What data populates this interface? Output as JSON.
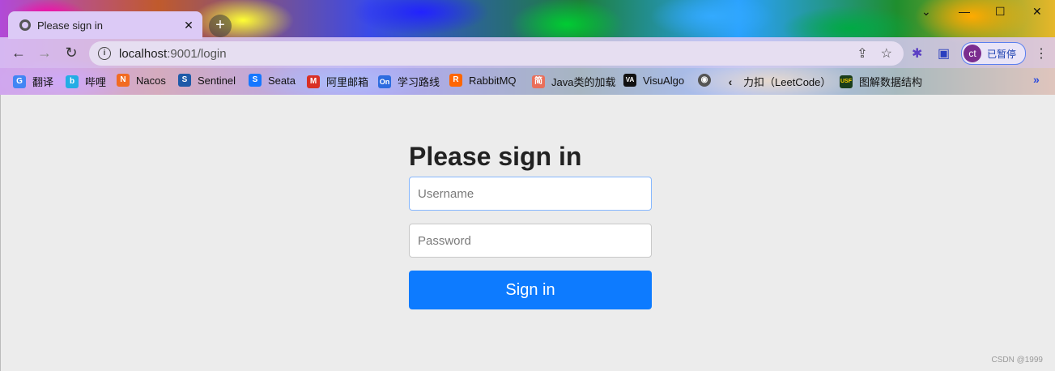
{
  "browser": {
    "tab_title": "Please sign in",
    "tab_close": "✕",
    "new_tab": "+",
    "url_host": "localhost",
    "url_rest": ":9001/login",
    "profile_initials": "ct",
    "profile_label": "已暂停",
    "bookmarks": [
      {
        "label": "翻译",
        "icon": "google-translate-icon",
        "color": "#4285f4",
        "glyph": "G"
      },
      {
        "label": "哔哩",
        "icon": "bilibili-icon",
        "color": "#23ade5",
        "glyph": "b"
      },
      {
        "label": "Nacos",
        "icon": "nacos-icon",
        "color": "#f26b22",
        "glyph": "N"
      },
      {
        "label": "Sentinel",
        "icon": "sentinel-icon",
        "color": "#1e5aa8",
        "glyph": "S"
      },
      {
        "label": "Seata",
        "icon": "seata-icon",
        "color": "#1677ff",
        "glyph": "S"
      },
      {
        "label": "阿里邮箱",
        "icon": "gmail-icon",
        "color": "#d93025",
        "glyph": "M"
      },
      {
        "label": "学习路线",
        "icon": "onenote-icon",
        "color": "#2d6cdf",
        "glyph": "On"
      },
      {
        "label": "RabbitMQ",
        "icon": "rabbitmq-icon",
        "color": "#ff6600",
        "glyph": "R"
      },
      {
        "label": "Java类的加载",
        "icon": "jianshu-icon",
        "color": "#ea6f5a",
        "glyph": "简"
      },
      {
        "label": "VisuAlgo",
        "icon": "visualgo-icon",
        "color": "#111111",
        "glyph": "VA"
      },
      {
        "label": "",
        "icon": "globe-icon",
        "color": "#555555",
        "glyph": "◉"
      },
      {
        "label": "力扣（LeetCode）",
        "icon": "leetcode-icon",
        "color": "#222222",
        "glyph": "‹"
      },
      {
        "label": "图解数据结构",
        "icon": "usfca-icon",
        "color": "#1a3d1a",
        "glyph": "USF"
      }
    ]
  },
  "login": {
    "heading": "Please sign in",
    "username_placeholder": "Username",
    "password_placeholder": "Password",
    "submit_label": "Sign in"
  },
  "watermark": "CSDN @1999"
}
